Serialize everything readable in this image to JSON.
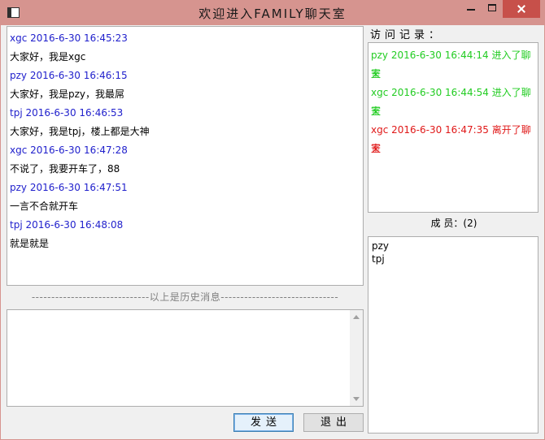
{
  "window": {
    "title": "欢迎进入FAMILY聊天室"
  },
  "chat": {
    "messages": [
      {
        "header": "xgc  2016-6-30 16:45:23",
        "text": "大家好，我是xgc"
      },
      {
        "header": "pzy  2016-6-30 16:46:15",
        "text": "大家好，我是pzy，我最屌"
      },
      {
        "header": "tpj  2016-6-30 16:46:53",
        "text": "大家好，我是tpj，楼上都是大神"
      },
      {
        "header": "xgc  2016-6-30 16:47:28",
        "text": "不说了，我要开车了，88"
      },
      {
        "header": "pzy  2016-6-30 16:47:51",
        "text": "一言不合就开车"
      },
      {
        "header": "tpj  2016-6-30 16:48:08",
        "text": "就是就是"
      }
    ],
    "header_color": "#1f1fcc"
  },
  "separator": {
    "text": "------------------------------以上是历史消息------------------------------"
  },
  "input": {
    "value": ""
  },
  "buttons": {
    "send_label": "发送",
    "quit_label": "退出"
  },
  "visits": {
    "label": "访问记录：",
    "entries": [
      {
        "line1": "pzy 2016-6-30 16:44:14 进入了聊天",
        "line2": "室",
        "color": "#22cc22"
      },
      {
        "line1": "xgc 2016-6-30 16:44:54 进入了聊天",
        "line2": "室",
        "color": "#22cc22"
      },
      {
        "line1": "xgc 2016-6-30 16:47:35 离开了聊天",
        "line2": "室",
        "color": "#e01818"
      }
    ]
  },
  "members": {
    "label": "成      员：(2)",
    "items": [
      "pzy",
      "tpj"
    ]
  }
}
